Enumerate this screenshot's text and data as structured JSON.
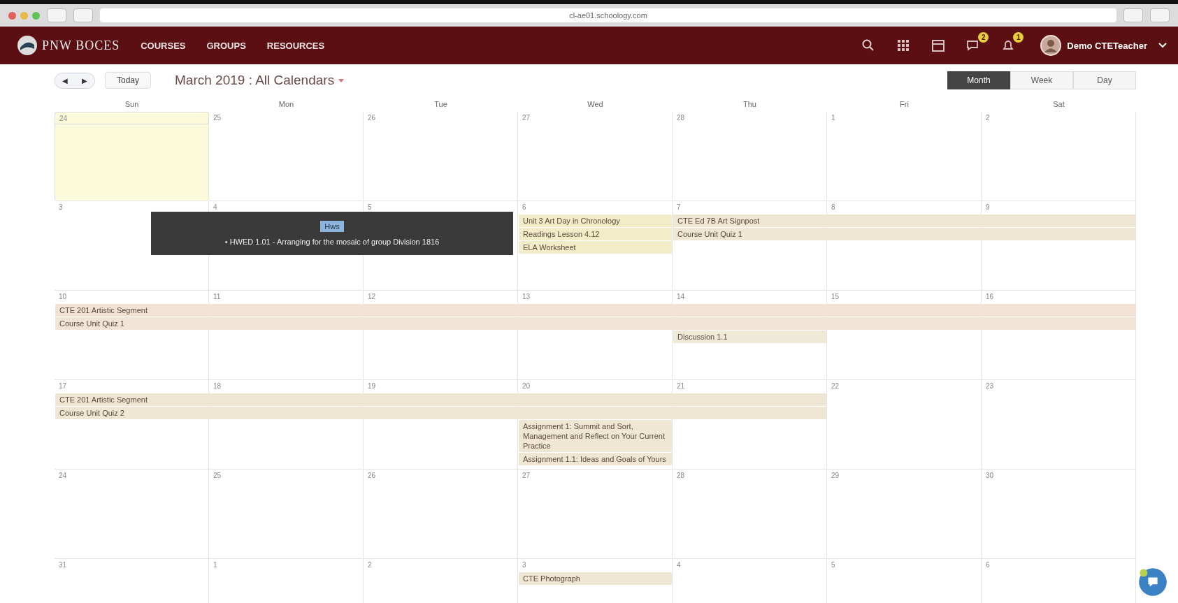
{
  "browser": {
    "url": "cl-ae01.schoology.com"
  },
  "header": {
    "logo": "PNW BOCES",
    "nav": [
      {
        "label": "COURSES"
      },
      {
        "label": "GROUPS"
      },
      {
        "label": "RESOURCES"
      }
    ],
    "messages_badge": "2",
    "notifications_badge": "1",
    "user": "Demo CTETeacher"
  },
  "toolbar": {
    "prev": "◀",
    "next": "▶",
    "today": "Today",
    "title": "March 2019 : All Calendars",
    "views": [
      {
        "label": "Month",
        "selected": true
      },
      {
        "label": "Week",
        "selected": false
      },
      {
        "label": "Day",
        "selected": false
      }
    ]
  },
  "weekdays": [
    "Sun",
    "Mon",
    "Tue",
    "Wed",
    "Thu",
    "Fri",
    "Sat"
  ],
  "weeks": [
    {
      "days": [
        {
          "number": "24",
          "today": true
        },
        {
          "number": "25",
          "today": false
        },
        {
          "number": "26",
          "today": false
        },
        {
          "number": "27",
          "today": false
        },
        {
          "number": "28",
          "today": false
        },
        {
          "number": "1",
          "today": false
        },
        {
          "number": "2",
          "today": false
        }
      ]
    },
    {
      "days": [
        {
          "number": "3",
          "today": false
        },
        {
          "number": "4",
          "today": false
        },
        {
          "number": "5",
          "today": false
        },
        {
          "number": "6",
          "today": false,
          "events": [
            {
              "kind": "start",
              "text": "Unit 3 Art Day in Chronology",
              "color": "#f3ecc9"
            },
            {
              "kind": "start",
              "text": "Readings Lesson 4.12",
              "color": "#f3ecc9"
            },
            {
              "kind": "start",
              "text": "ELA Worksheet",
              "color": "#f3ecc9"
            }
          ]
        },
        {
          "number": "7",
          "today": false,
          "events": [
            {
              "kind": "start",
              "text": "CTE Ed 7B Art Signpost",
              "color": "#efe6d3"
            },
            {
              "kind": "start",
              "text": "Course Unit Quiz 1",
              "color": "#efe6d3"
            }
          ]
        },
        {
          "number": "8",
          "today": false,
          "events": [
            {
              "kind": "continued"
            },
            {
              "kind": "continued"
            }
          ]
        },
        {
          "number": "9",
          "today": false,
          "events": [
            {
              "kind": "continued"
            },
            {
              "kind": "continued"
            }
          ]
        }
      ],
      "tooltip": {
        "tag": "Hws",
        "text": "• HWED 1.01 - Arranging for the mosaic of group Division 1816"
      }
    },
    {
      "days": [
        {
          "number": "10",
          "today": false,
          "events": [
            {
              "kind": "start",
              "text": "CTE 201 Artistic Segment",
              "color": "#f3e2d4"
            },
            {
              "kind": "start",
              "text": "Course Unit Quiz 1",
              "color": "#f1e5d6"
            }
          ]
        },
        {
          "number": "11",
          "today": false,
          "events": [
            {
              "kind": "continued"
            },
            {
              "kind": "continued"
            }
          ]
        },
        {
          "number": "12",
          "today": false,
          "events": [
            {
              "kind": "continued"
            },
            {
              "kind": "continued"
            }
          ]
        },
        {
          "number": "13",
          "today": false,
          "events": [
            {
              "kind": "continued"
            },
            {
              "kind": "continued"
            }
          ]
        },
        {
          "number": "14",
          "today": false,
          "events": [
            {
              "kind": "continued"
            },
            {
              "kind": "continued"
            },
            {
              "kind": "start",
              "text": "Discussion 1.1",
              "color": "#efe9d8"
            }
          ]
        },
        {
          "number": "15",
          "today": false,
          "events": [
            {
              "kind": "continued"
            },
            {
              "kind": "continued"
            }
          ]
        },
        {
          "number": "16",
          "today": false,
          "events": [
            {
              "kind": "continued"
            },
            {
              "kind": "continued"
            }
          ]
        }
      ]
    },
    {
      "days": [
        {
          "number": "17",
          "today": false,
          "events": [
            {
              "kind": "start",
              "text": "CTE 201 Artistic Segment",
              "color": "#efe6d3"
            },
            {
              "kind": "start",
              "text": "Course Unit Quiz 2",
              "color": "#efe6d3"
            }
          ]
        },
        {
          "number": "18",
          "today": false,
          "events": [
            {
              "kind": "continued"
            },
            {
              "kind": "continued"
            }
          ]
        },
        {
          "number": "19",
          "today": false,
          "events": [
            {
              "kind": "continued"
            },
            {
              "kind": "continued"
            }
          ]
        },
        {
          "number": "20",
          "today": false,
          "events": [
            {
              "kind": "continued"
            },
            {
              "kind": "continued"
            },
            {
              "kind": "start",
              "text": "Assignment 1: Summit and Sort, Management and Reflect on Your Current Practice",
              "color": "#efe6d3"
            },
            {
              "kind": "start",
              "text": "Assignment 1.1: Ideas and Goals of Yours",
              "color": "#efe6d3"
            }
          ]
        },
        {
          "number": "21",
          "today": false,
          "events": [
            {
              "kind": "continued"
            },
            {
              "kind": "continued"
            }
          ]
        },
        {
          "number": "22",
          "today": false
        },
        {
          "number": "23",
          "today": false
        }
      ]
    },
    {
      "days": [
        {
          "number": "24",
          "today": false
        },
        {
          "number": "25",
          "today": false
        },
        {
          "number": "26",
          "today": false
        },
        {
          "number": "27",
          "today": false
        },
        {
          "number": "28",
          "today": false
        },
        {
          "number": "29",
          "today": false
        },
        {
          "number": "30",
          "today": false
        }
      ]
    },
    {
      "days": [
        {
          "number": "31",
          "today": false
        },
        {
          "number": "1",
          "today": false
        },
        {
          "number": "2",
          "today": false
        },
        {
          "number": "3",
          "today": false,
          "events": [
            {
              "kind": "start",
              "text": "CTE Photograph",
              "color": "#efe6d3"
            }
          ]
        },
        {
          "number": "4",
          "today": false
        },
        {
          "number": "5",
          "today": false
        },
        {
          "number": "6",
          "today": false
        }
      ]
    }
  ]
}
